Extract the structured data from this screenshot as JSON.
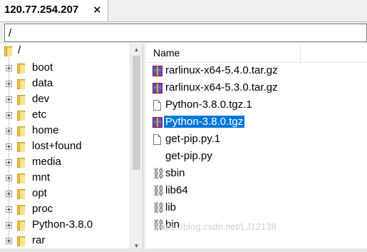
{
  "tab": {
    "title": "120.77.254.207",
    "close": "✕"
  },
  "path": {
    "value": "/"
  },
  "tree": {
    "root": "/",
    "items": [
      "boot",
      "data",
      "dev",
      "etc",
      "home",
      "lost+found",
      "media",
      "mnt",
      "opt",
      "proc",
      "Python-3.8.0",
      "rar"
    ]
  },
  "files": {
    "column_name": "Name",
    "rows": [
      {
        "name": "rarlinux-x64-5.4.0.tar.gz",
        "icon": "rar-archive-icon"
      },
      {
        "name": "rarlinux-x64-5.3.0.tar.gz",
        "icon": "rar-archive-icon"
      },
      {
        "name": "Python-3.8.0.tgz.1",
        "icon": "document-icon"
      },
      {
        "name": "Python-3.8.0.tgz",
        "icon": "rar-archive-icon",
        "selected": true
      },
      {
        "name": "get-pip.py.1",
        "icon": "document-icon"
      },
      {
        "name": "get-pip.py",
        "icon": "none"
      },
      {
        "name": "sbin",
        "icon": "link-icon"
      },
      {
        "name": "lib64",
        "icon": "link-icon"
      },
      {
        "name": "lib",
        "icon": "link-icon"
      },
      {
        "name": "bin",
        "icon": "link-icon"
      }
    ]
  },
  "watermark": "https://blog.csdn.net/LJ12138",
  "colors": {
    "selection": "#0078d7",
    "folder": "#f2c84b"
  }
}
